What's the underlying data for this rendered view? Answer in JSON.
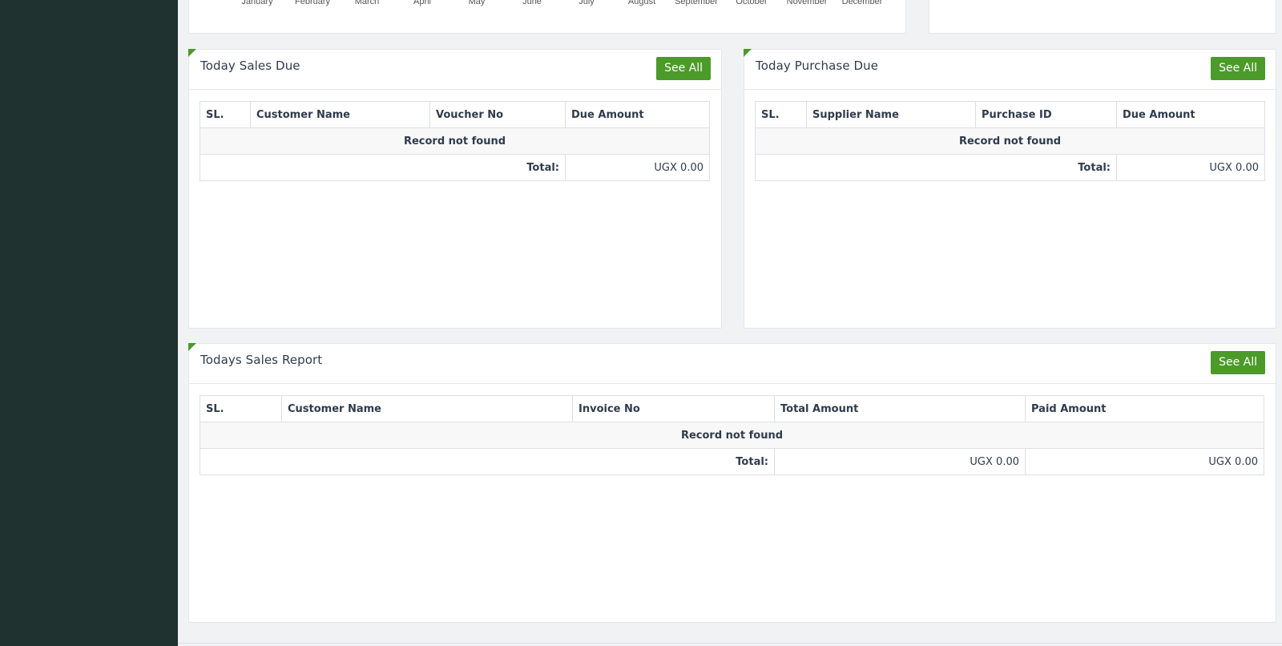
{
  "chart": {
    "months": [
      "January",
      "February",
      "March",
      "April",
      "May",
      "June",
      "July",
      "August",
      "September",
      "October",
      "November",
      "December"
    ]
  },
  "sales_due": {
    "title": "Today Sales Due",
    "see_all": "See All",
    "columns": [
      "SL.",
      "Customer Name",
      "Voucher No",
      "Due Amount"
    ],
    "empty_text": "Record not found",
    "total_label": "Total:",
    "total_due": "UGX 0.00"
  },
  "purchase_due": {
    "title": "Today Purchase Due",
    "see_all": "See All",
    "columns": [
      "SL.",
      "Supplier Name",
      "Purchase ID",
      "Due Amount"
    ],
    "empty_text": "Record not found",
    "total_label": "Total:",
    "total_due": "UGX 0.00"
  },
  "sales_report": {
    "title": "Todays Sales Report",
    "see_all": "See All",
    "columns": [
      "SL.",
      "Customer Name",
      "Invoice No",
      "Total Amount",
      "Paid Amount"
    ],
    "empty_text": "Record not found",
    "total_label": "Total:",
    "total_amount": "UGX 0.00",
    "paid_amount": "UGX 0.00"
  },
  "colors": {
    "sidebar": "#203230",
    "accent": "#4c9a2a"
  }
}
